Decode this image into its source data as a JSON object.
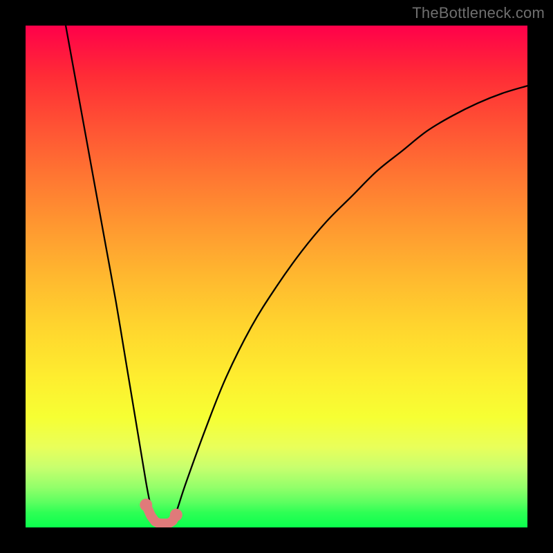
{
  "watermark": "TheBottleneck.com",
  "chart_data": {
    "type": "line",
    "title": "",
    "xlabel": "",
    "ylabel": "",
    "xlim": [
      0,
      100
    ],
    "ylim": [
      0,
      100
    ],
    "legend": false,
    "grid": false,
    "series": [
      {
        "name": "bottleneck-curve",
        "x": [
          8,
          10,
          12,
          14,
          16,
          18,
          20,
          22,
          24,
          25,
          26,
          27,
          28,
          29,
          30,
          32,
          36,
          40,
          45,
          50,
          55,
          60,
          65,
          70,
          75,
          80,
          85,
          90,
          95,
          100
        ],
        "values": [
          100,
          89,
          78,
          67,
          56,
          45,
          33,
          21,
          9,
          4,
          1,
          0.5,
          0.5,
          1,
          3,
          9,
          20,
          30,
          40,
          48,
          55,
          61,
          66,
          71,
          75,
          79,
          82,
          84.5,
          86.5,
          88
        ]
      }
    ],
    "markers": {
      "name": "salient-points-near-minimum",
      "color": "#e07a7a",
      "points_x": [
        24.0,
        25.0,
        25.8,
        26.6,
        28.5,
        29.3,
        30.0
      ],
      "points_value": [
        4.5,
        2.3,
        1.2,
        0.8,
        0.8,
        1.3,
        2.5
      ],
      "radius_small": 6,
      "radius_large": 9
    },
    "background_gradient": {
      "top": "#ff004a",
      "mid": "#ffd52e",
      "bottom": "#0aff4d"
    }
  }
}
